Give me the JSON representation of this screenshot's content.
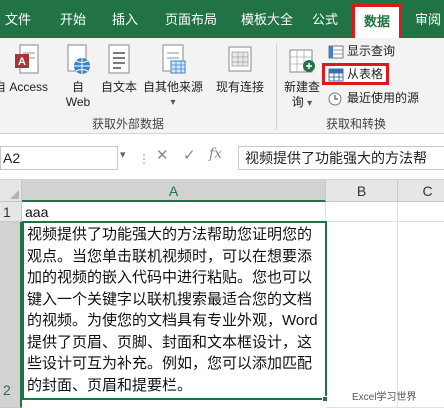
{
  "ribbon_tabs": [
    "文件",
    "开始",
    "插入",
    "页面布局",
    "模板大全",
    "公式",
    "数据",
    "审阅"
  ],
  "active_tab": "数据",
  "get_external_data": {
    "buttons": [
      {
        "label1": "自 Access",
        "label2": ""
      },
      {
        "label1": "自",
        "label2": "Web"
      },
      {
        "label1": "自文本",
        "label2": ""
      },
      {
        "label1": "自其他来源",
        "label2": ""
      },
      {
        "label1": "现有连接",
        "label2": ""
      }
    ],
    "group_label": "获取外部数据"
  },
  "get_transform": {
    "new_query_label1": "新建查",
    "new_query_label2": "询",
    "show_queries": "显示查询",
    "from_table": "从表格",
    "recent_sources": "最近使用的源",
    "group_label": "获取和转换"
  },
  "formula_bar": {
    "name_box": "A2",
    "fx": "fx",
    "cancel": "✕",
    "enter": "✓",
    "content": "视频提供了功能强大的方法帮"
  },
  "columns": [
    "A",
    "B",
    "C"
  ],
  "rows": [
    "1",
    "2"
  ],
  "cells": {
    "A1": "aaa",
    "A2": "视频提供了功能强大的方法帮助您证明您的观点。当您单击联机视频时，可以在想要添加的视频的嵌入代码中进行粘贴。您也可以键入一个关键字以联机搜索最适合您的文档的视频。为使您的文档具有专业外观，Word 提供了页眉、页脚、封面和文本框设计，这些设计可互为补充。例如，您可以添加匹配的封面、页眉和提要栏。"
  },
  "watermark": "Excel学习世界",
  "colors": {
    "excel_green": "#217346",
    "highlight_red": "#e01818",
    "ribbon_bg": "#f3f3f3"
  }
}
